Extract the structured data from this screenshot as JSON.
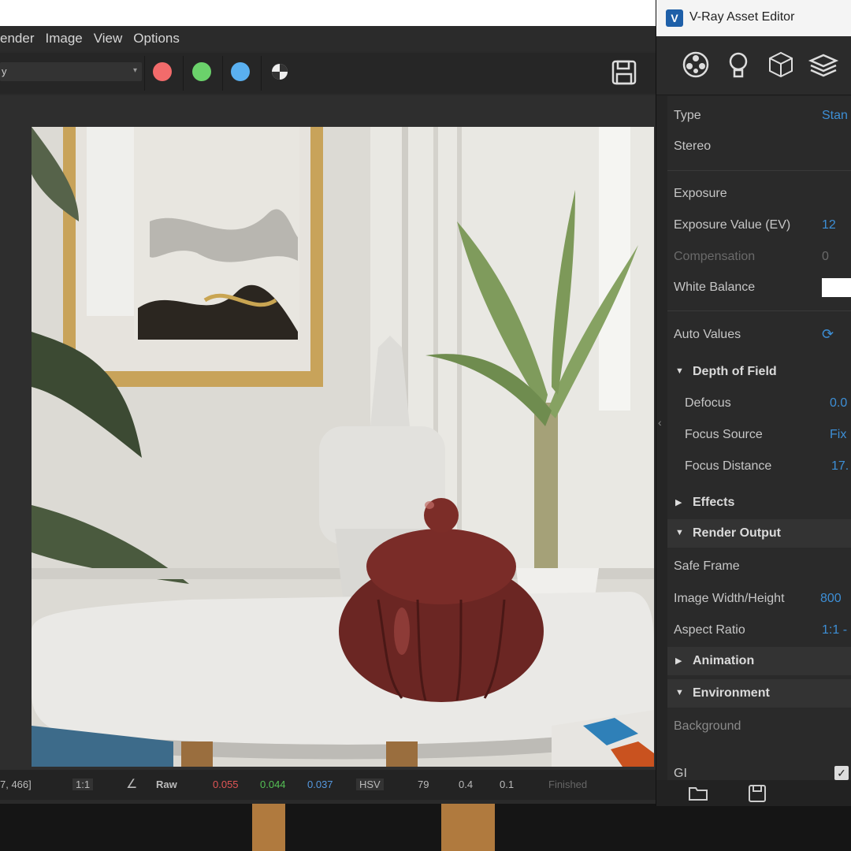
{
  "menu": {
    "items": [
      "ender",
      "Image",
      "View",
      "Options"
    ]
  },
  "toolbar": {
    "channel_value": "y"
  },
  "render_window": {
    "status": {
      "coords": "7, 466]",
      "zoom": "1:1",
      "mode": "Raw",
      "r": "0.055",
      "g": "0.044",
      "b": "0.037",
      "colorspace": "HSV",
      "v1": "79",
      "v2": "0.4",
      "v3": "0.1",
      "state": "Finished"
    }
  },
  "asset_editor": {
    "title": "V-Ray Asset Editor",
    "tabs": [
      "materials-icon",
      "lights-icon",
      "geometry-icon",
      "layers-icon"
    ],
    "rows": {
      "type_label": "Type",
      "type_value": "Stan",
      "stereo_label": "Stereo",
      "exposure_label": "Exposure",
      "ev_label": "Exposure Value (EV)",
      "ev_value": "12",
      "comp_label": "Compensation",
      "comp_value": "0",
      "wb_label": "White Balance",
      "auto_label": "Auto Values",
      "dof_header": "Depth of Field",
      "defocus_label": "Defocus",
      "defocus_value": "0.0",
      "focus_source_label": "Focus Source",
      "focus_source_value": "Fix",
      "focus_dist_label": "Focus Distance",
      "focus_dist_value": "17.",
      "effects_header": "Effects",
      "render_output_header": "Render Output",
      "safe_frame_label": "Safe Frame",
      "img_wh_label": "Image Width/Height",
      "img_wh_value": "800",
      "aspect_label": "Aspect Ratio",
      "aspect_value": "1:1 -",
      "animation_header": "Animation",
      "environment_header": "Environment",
      "background_label": "Background",
      "gi_label": "GI"
    }
  },
  "colors": {
    "red": "#f26b6b",
    "green": "#6bd26b",
    "blue": "#5ab0f0",
    "accent": "#3d8fd6"
  }
}
